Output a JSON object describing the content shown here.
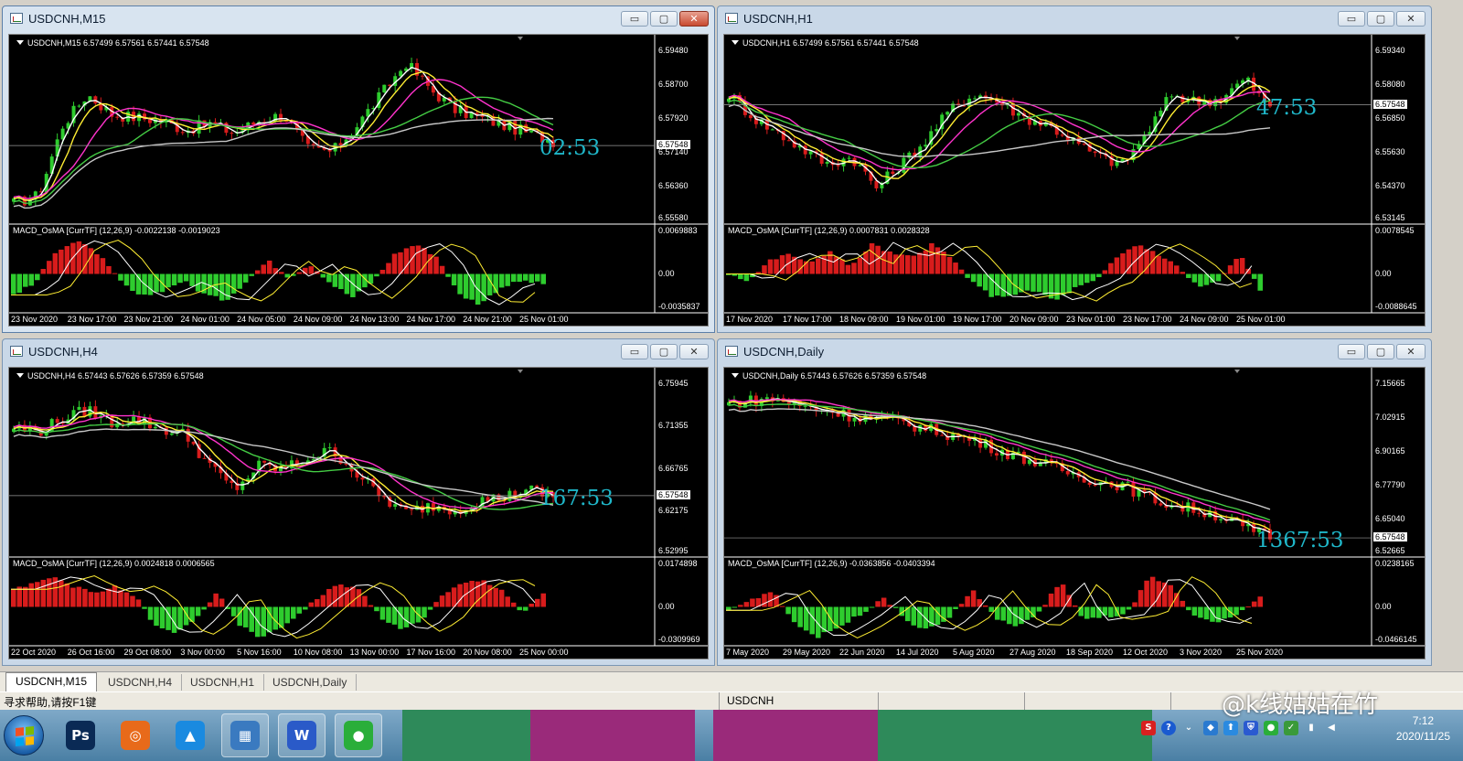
{
  "windows": [
    {
      "id": "m15",
      "title": "USDCNH,M15",
      "header": "USDCNH,M15  6.57499 6.57561 6.57441 6.57548",
      "osma": "MACD_OsMA [CurrTF] (12,26,9) -0.0022138 -0.0019023",
      "timer": "02:53",
      "price_labels": [
        "6.59480",
        "6.58700",
        "6.57920",
        "6.57140",
        "6.56360",
        "6.55580"
      ],
      "current_price": "6.57548",
      "osma_labels": [
        "0.0069883",
        "0.00",
        "-0.0035837"
      ],
      "time_labels": [
        "23 Nov 2020",
        "23 Nov 17:00",
        "23 Nov 21:00",
        "24 Nov 01:00",
        "24 Nov 05:00",
        "24 Nov 09:00",
        "24 Nov 13:00",
        "24 Nov 17:00",
        "24 Nov 21:00",
        "25 Nov 01:00"
      ],
      "active": true
    },
    {
      "id": "h1",
      "title": "USDCNH,H1",
      "header": "USDCNH,H1  6.57499 6.57561 6.57441 6.57548",
      "osma": "MACD_OsMA [CurrTF] (12,26,9) 0.0007831 0.0028328",
      "timer": "47:53",
      "price_labels": [
        "6.59340",
        "6.58080",
        "6.56850",
        "6.55630",
        "6.54370",
        "6.53145"
      ],
      "current_price": "6.57548",
      "osma_labels": [
        "0.0078545",
        "0.00",
        "-0.0088645"
      ],
      "time_labels": [
        "17 Nov 2020",
        "17 Nov 17:00",
        "18 Nov 09:00",
        "19 Nov 01:00",
        "19 Nov 17:00",
        "20 Nov 09:00",
        "23 Nov 01:00",
        "23 Nov 17:00",
        "24 Nov 09:00",
        "25 Nov 01:00"
      ],
      "active": false
    },
    {
      "id": "h4",
      "title": "USDCNH,H4",
      "header": "USDCNH,H4  6.57443 6.57626 6.57359 6.57548",
      "osma": "MACD_OsMA [CurrTF] (12,26,9) 0.0024818 0.0006565",
      "timer": "167:53",
      "price_labels": [
        "6.75945",
        "6.71355",
        "6.66765",
        "6.62175",
        "6.52995"
      ],
      "current_price": "6.57548",
      "osma_labels": [
        "0.0174898",
        "0.00",
        "-0.0309969"
      ],
      "time_labels": [
        "22 Oct 2020",
        "26 Oct 16:00",
        "29 Oct 08:00",
        "3 Nov 00:00",
        "5 Nov 16:00",
        "10 Nov 08:00",
        "13 Nov 00:00",
        "17 Nov 16:00",
        "20 Nov 08:00",
        "25 Nov 00:00"
      ],
      "active": false
    },
    {
      "id": "daily",
      "title": "USDCNH,Daily",
      "header": "USDCNH,Daily  6.57443 6.57626 6.57359 6.57548",
      "osma": "MACD_OsMA [CurrTF] (12,26,9) -0.0363856 -0.0403394",
      "timer": "1367:53",
      "price_labels": [
        "7.15665",
        "7.02915",
        "6.90165",
        "6.77790",
        "6.65040",
        "6.52665"
      ],
      "current_price": "6.57548",
      "osma_labels": [
        "0.0238165",
        "0.00",
        "-0.0466145"
      ],
      "time_labels": [
        "7 May 2020",
        "29 May 2020",
        "22 Jun 2020",
        "14 Jul 2020",
        "5 Aug 2020",
        "27 Aug 2020",
        "18 Sep 2020",
        "12 Oct 2020",
        "3 Nov 2020",
        "25 Nov 2020"
      ],
      "active": false
    }
  ],
  "window_buttons": {
    "minimize": "▭",
    "maximize": "▢",
    "close": "✕"
  },
  "tabs": [
    "USDCNH,M15",
    "USDCNH,H4",
    "USDCNH,H1",
    "USDCNH,Daily"
  ],
  "status": {
    "help": "寻求帮助,请按F1键",
    "symbol": "USDCNH"
  },
  "taskbar": {
    "apps": [
      {
        "name": "photoshop",
        "label": "Ps",
        "color": "#0a2a55"
      },
      {
        "name": "browser",
        "label": "◎",
        "color": "#e86a1a"
      },
      {
        "name": "cloud-app",
        "label": "▲",
        "color": "#1a8ae0"
      },
      {
        "name": "metatrader",
        "label": "▦",
        "color": "#3a7ac0"
      },
      {
        "name": "wps-writer",
        "label": "W",
        "color": "#2a5ac8"
      },
      {
        "name": "wechat",
        "label": "●",
        "color": "#2aae3a"
      }
    ],
    "clock_time": "7:12",
    "clock_date": "2020/11/25"
  },
  "watermark": "@k线姑姑在竹",
  "colors": {
    "bull": "#2ecc2e",
    "bear": "#d81c1c",
    "ma_fast": "#ffffff",
    "ma_yellow": "#ffee33",
    "ma_magenta": "#ff33cc",
    "ma_green": "#44cc44",
    "ma_gray": "#c8c8c8",
    "timer": "#1fb7c9"
  }
}
